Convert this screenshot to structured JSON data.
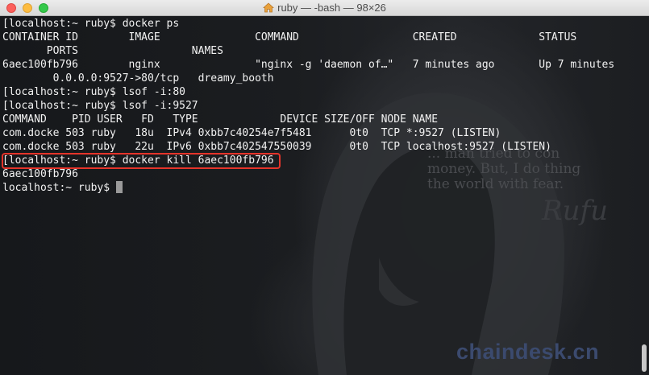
{
  "window": {
    "title": "ruby — -bash — 98×26"
  },
  "terminal": {
    "lines": [
      "[localhost:~ ruby$ docker ps",
      "CONTAINER ID        IMAGE               COMMAND                  CREATED             STATUS",
      "       PORTS                  NAMES",
      "6aec100fb796        nginx               \"nginx -g 'daemon of…\"   7 minutes ago       Up 7 minutes",
      "        0.0.0.0:9527->80/tcp   dreamy_booth",
      "[localhost:~ ruby$ lsof -i:80",
      "[localhost:~ ruby$ lsof -i:9527",
      "COMMAND    PID USER   FD   TYPE             DEVICE SIZE/OFF NODE NAME",
      "com.docke 503 ruby   18u  IPv4 0xbb7c40254e7f5481      0t0  TCP *:9527 (LISTEN)",
      "com.docke 503 ruby   22u  IPv6 0xbb7c402547550039      0t0  TCP localhost:9527 (LISTEN)",
      "[localhost:~ ruby$ docker kill 6aec100fb796",
      "6aec100fb796",
      "localhost:~ ruby$ "
    ],
    "highlight_color": "#e5342a"
  },
  "background": {
    "quote": "... man tried to con\nmoney. But, I do thing\nthe world with fear.",
    "signature": "Rufu",
    "watermark": "chaindesk.cn"
  },
  "icons": {
    "title_icon": "home-folder-icon"
  }
}
